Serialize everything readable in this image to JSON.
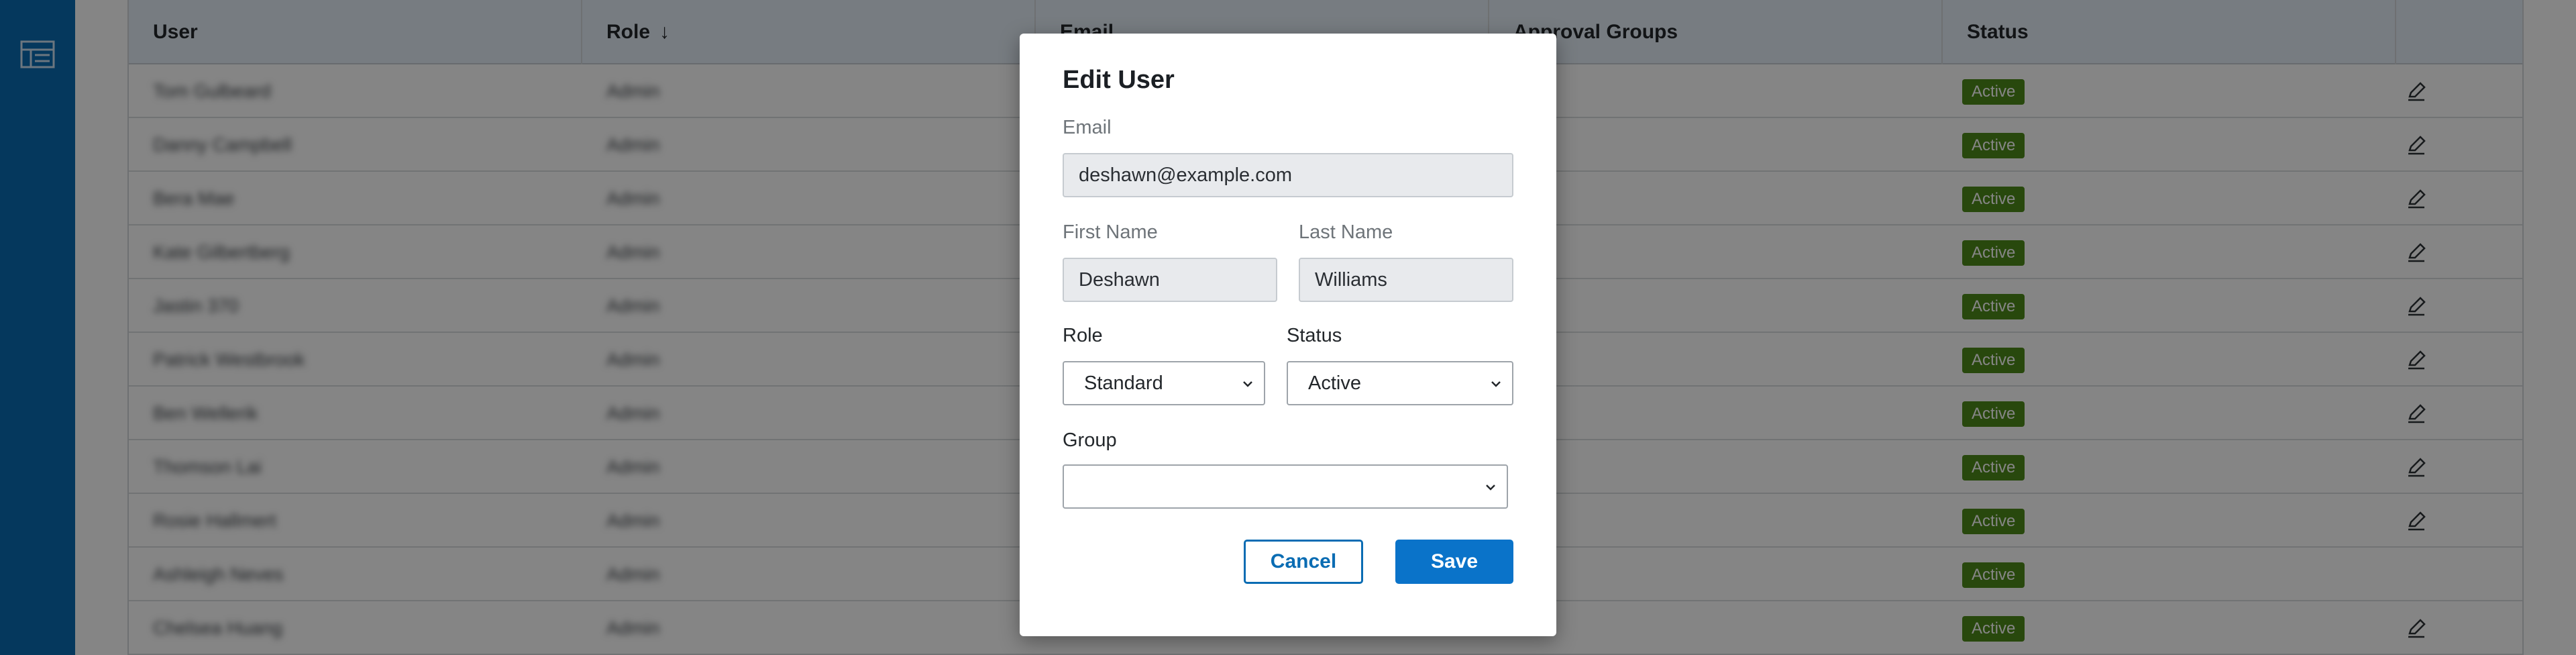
{
  "table": {
    "columns": {
      "user": "User",
      "role": "Role",
      "email": "Email",
      "approval_groups": "Approval Groups",
      "status": "Status"
    },
    "sort_indicator": "↓",
    "rows": [
      {
        "user": "Tom Gulbeard",
        "role": "Admin",
        "status": "Active",
        "editable": true
      },
      {
        "user": "Danny Campbell",
        "role": "Admin",
        "status": "Active",
        "editable": true
      },
      {
        "user": "Bera Mae",
        "role": "Admin",
        "status": "Active",
        "editable": true
      },
      {
        "user": "Kate Gilbertberg",
        "role": "Admin",
        "status": "Active",
        "editable": true
      },
      {
        "user": "Jastin 370",
        "role": "Admin",
        "status": "Active",
        "editable": true
      },
      {
        "user": "Patrick Westbrook",
        "role": "Admin",
        "status": "Active",
        "editable": true
      },
      {
        "user": "Ben Wellerik",
        "role": "Admin",
        "status": "Active",
        "editable": true
      },
      {
        "user": "Thomson Lai",
        "role": "Admin",
        "status": "Active",
        "editable": true
      },
      {
        "user": "Rosie Hallmert",
        "role": "Admin",
        "status": "Active",
        "editable": true
      },
      {
        "user": "Ashleigh Neves",
        "role": "Admin",
        "status": "Active",
        "editable": false
      },
      {
        "user": "Chelsea Huang",
        "role": "Admin",
        "status": "Active",
        "editable": true
      }
    ]
  },
  "modal": {
    "title": "Edit User",
    "email_label": "Email",
    "email_value": "deshawn@example.com",
    "first_name_label": "First Name",
    "first_name_value": "Deshawn",
    "last_name_label": "Last Name",
    "last_name_value": "Williams",
    "role_label": "Role",
    "role_value": "Standard",
    "status_label": "Status",
    "status_value": "Active",
    "group_label": "Group",
    "group_value": "",
    "cancel_label": "Cancel",
    "save_label": "Save"
  },
  "colors": {
    "brand_blue": "#0a6cb3",
    "status_active": "#4e8a1a",
    "header_bg": "#e5eef7"
  },
  "icons": {
    "rail": "table-list-icon",
    "edit": "pencil-icon",
    "select": "chevron-down-icon"
  }
}
